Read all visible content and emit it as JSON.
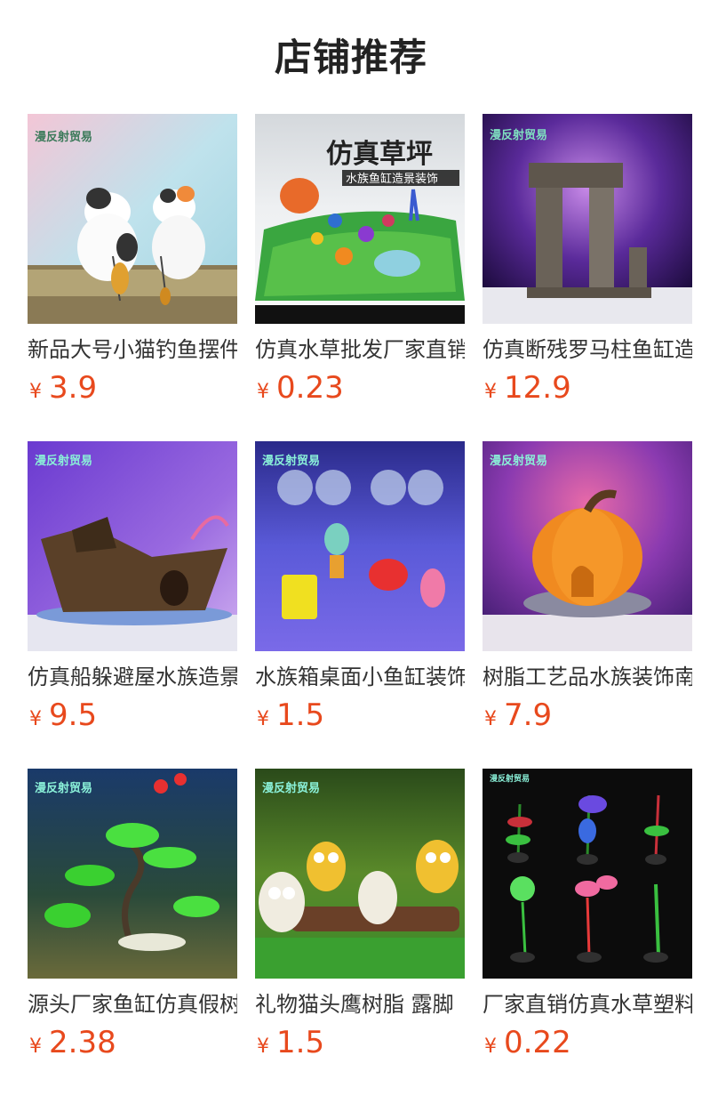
{
  "header": {
    "title": "店铺推荐"
  },
  "currency_symbol": "¥",
  "colors": {
    "price": "#e8491d",
    "title": "#222222",
    "text": "#333333"
  },
  "products": [
    {
      "name": "新品大号小猫钓鱼摆件",
      "price": "3.9",
      "image": "cat-fishing-figurines-image"
    },
    {
      "name": "仿真水草批发厂家直销",
      "price": "0.23",
      "image": "artificial-grass-mat-image",
      "banner_title": "仿真草坪",
      "banner_subtitle": "水族鱼缸造景装饰"
    },
    {
      "name": "仿真断残罗马柱鱼缸造景",
      "price": "12.9",
      "image": "roman-column-ruin-image"
    },
    {
      "name": "仿真船躲避屋水族造景",
      "price": "9.5",
      "image": "shipwreck-hideout-image"
    },
    {
      "name": "水族箱桌面小鱼缸装饰",
      "price": "1.5",
      "image": "cartoon-hanging-ornaments-image"
    },
    {
      "name": "树脂工艺品水族装饰南瓜",
      "price": "7.9",
      "image": "pumpkin-house-image"
    },
    {
      "name": "源头厂家鱼缸仿真假树",
      "price": "2.38",
      "image": "bonsai-tree-image"
    },
    {
      "name": "礼物猫头鹰树脂 露脚",
      "price": "1.5",
      "image": "owl-figurines-image"
    },
    {
      "name": "厂家直销仿真水草塑料",
      "price": "0.22",
      "image": "plastic-water-plants-image"
    }
  ]
}
